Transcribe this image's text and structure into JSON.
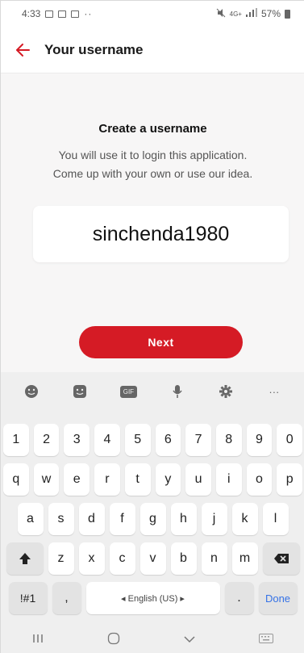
{
  "status": {
    "time": "4:33",
    "right_text": "4G+",
    "battery": "57%"
  },
  "header": {
    "title": "Your username",
    "back_icon": "back-arrow-icon"
  },
  "main": {
    "heading": "Create a username",
    "sub_line1": "You will use it to login this application.",
    "sub_line2": "Come up with your own or use our idea.",
    "username_value": "sinchenda1980",
    "next_label": "Next"
  },
  "keyboard": {
    "toolbar_icons": [
      "emoji-icon",
      "sticker-icon",
      "gif-icon",
      "mic-icon",
      "settings-icon",
      "more-icon"
    ],
    "gif_label": "GIF",
    "more_label": "···",
    "row_numbers": [
      "1",
      "2",
      "3",
      "4",
      "5",
      "6",
      "7",
      "8",
      "9",
      "0"
    ],
    "row_q": [
      "q",
      "w",
      "e",
      "r",
      "t",
      "y",
      "u",
      "i",
      "o",
      "p"
    ],
    "row_a": [
      "a",
      "s",
      "d",
      "f",
      "g",
      "h",
      "j",
      "k",
      "l"
    ],
    "row_z": [
      "z",
      "x",
      "c",
      "v",
      "b",
      "n",
      "m"
    ],
    "sym_label": "!#1",
    "comma_label": ",",
    "space_label": "◂ English (US) ▸",
    "period_label": ".",
    "done_label": "Done"
  },
  "colors": {
    "accent": "#d51b25",
    "done_blue": "#3572e6"
  }
}
